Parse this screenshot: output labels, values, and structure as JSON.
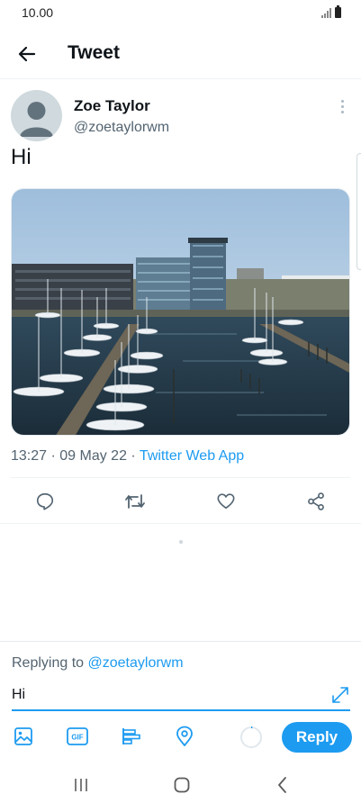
{
  "status_bar": {
    "time": "10.00"
  },
  "header": {
    "title": "Tweet"
  },
  "tweet": {
    "author_name": "Zoe Taylor",
    "author_handle": "@zoetaylorwm",
    "text": "Hi",
    "time": "13:27",
    "date": "09 May 22",
    "separator": " · ",
    "source": "Twitter Web App",
    "media_description": "Harbour marina with sailboats and modern glass buildings"
  },
  "actions": [
    "reply-icon",
    "retweet-icon",
    "like-icon",
    "share-icon"
  ],
  "compose": {
    "replying_prefix": "Replying to ",
    "replying_to": "@zoetaylorwm",
    "input_value": "Hi",
    "reply_label": "Reply",
    "tools": [
      "image-icon",
      "gif-icon",
      "poll-icon",
      "location-icon"
    ],
    "gif_label": "GIF"
  },
  "colors": {
    "accent": "#1d9bf0",
    "text": "#0f1419",
    "muted": "#536471"
  }
}
